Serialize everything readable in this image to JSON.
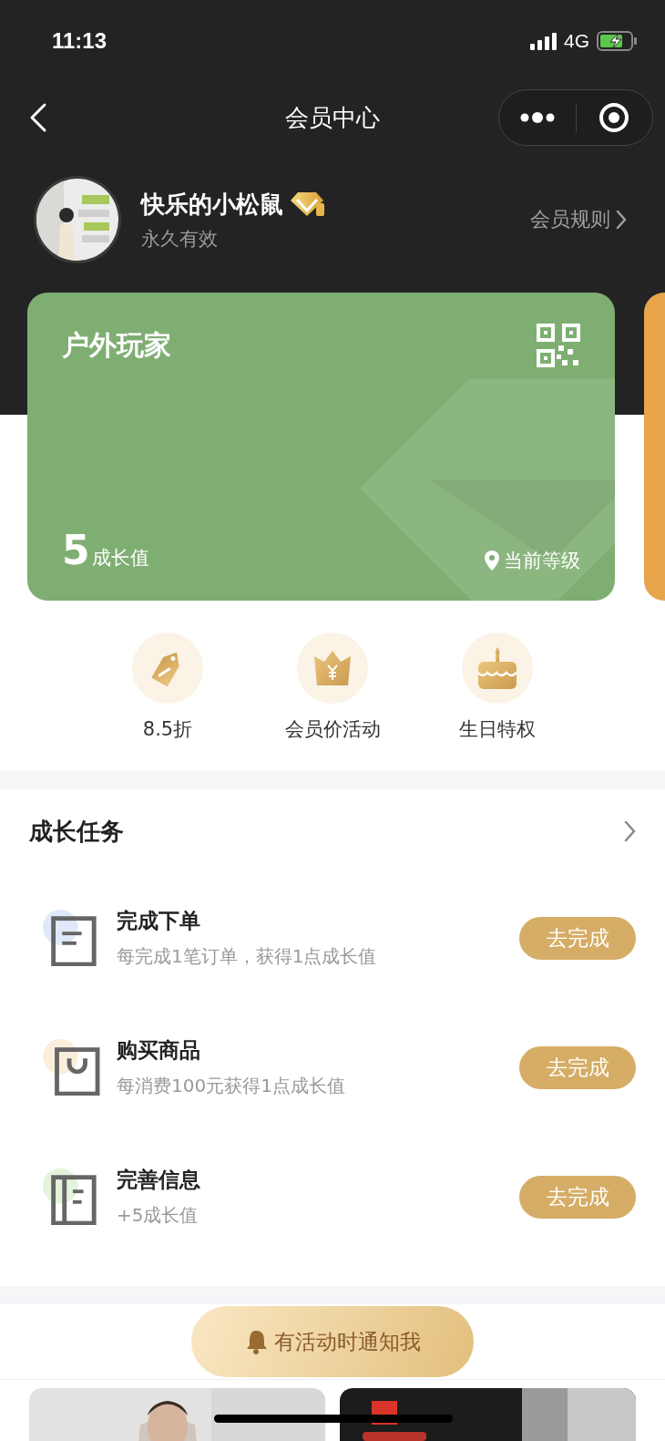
{
  "status_bar": {
    "time": "11:13",
    "network": "4G"
  },
  "nav": {
    "title": "会员中心"
  },
  "profile": {
    "name": "快乐的小松鼠",
    "validity": "永久有效",
    "rules_link": "会员规则"
  },
  "cards": [
    {
      "kind": "full",
      "level_name": "户外玩家",
      "growth_value": "5",
      "growth_label": "成长值",
      "current_label": "当前等级",
      "color": "#7fae72"
    },
    {
      "kind": "peek",
      "color": "#e8a54b"
    }
  ],
  "benefits": [
    {
      "kind": "tag",
      "label": "8.5折"
    },
    {
      "kind": "crown",
      "label": "会员价活动"
    },
    {
      "kind": "cake",
      "label": "生日特权"
    }
  ],
  "tasks": {
    "title": "成长任务",
    "items": [
      {
        "kind": "order",
        "title": "完成下单",
        "description": "每完成1笔订单，获得1点成长值",
        "color": "#dfe9fb",
        "button": "去完成"
      },
      {
        "kind": "bag",
        "title": "购买商品",
        "description": "每消费100元获得1点成长值",
        "color": "#fbefdc",
        "button": "去完成"
      },
      {
        "kind": "info",
        "title": "完善信息",
        "description": "+5成长值",
        "color": "#e3f3dc",
        "button": "去完成"
      }
    ]
  },
  "notify_button": "有活动时通知我"
}
